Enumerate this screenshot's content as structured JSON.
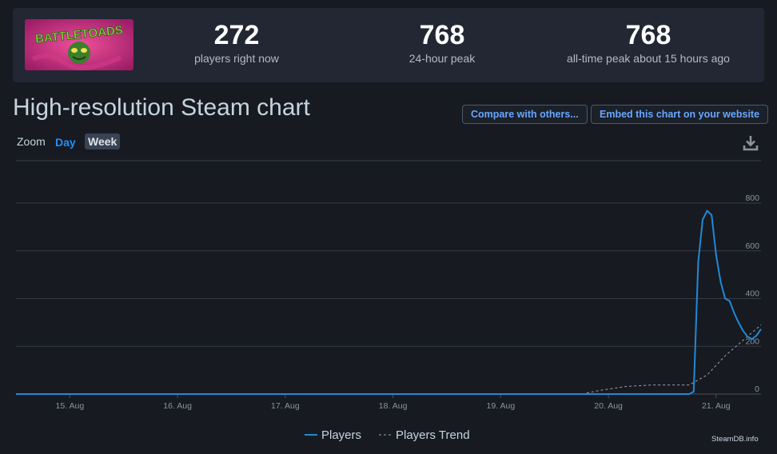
{
  "header": {
    "game_logo_text": "BATTLETOADS",
    "stats": [
      {
        "value": "272",
        "label": "players right now"
      },
      {
        "value": "768",
        "label": "24-hour peak"
      },
      {
        "value": "768",
        "label": "all-time peak about 15 hours ago"
      }
    ]
  },
  "page_title": "High-resolution Steam chart",
  "buttons": {
    "compare": "Compare with others...",
    "embed": "Embed this chart on your website"
  },
  "zoom": {
    "label": "Zoom",
    "options": [
      "Day",
      "Week"
    ],
    "selected": "Week"
  },
  "icons": {
    "download": "download-icon"
  },
  "colors": {
    "background": "#171a21",
    "players_line": "#1f8ad6",
    "trend_line": "#9aa4ae",
    "link_blue": "#67a7ff"
  },
  "credit": "SteamDB.info",
  "chart_data": {
    "type": "line",
    "title": "",
    "xlabel": "",
    "ylabel": "",
    "x_ticks": [
      "15. Aug",
      "16. Aug",
      "17. Aug",
      "18. Aug",
      "19. Aug",
      "20. Aug",
      "21. Aug"
    ],
    "y_ticks": [
      0,
      200,
      400,
      600,
      800
    ],
    "xlim": [
      "2020-08-14 12:00",
      "2020-08-21 10:00"
    ],
    "ylim": [
      0,
      800
    ],
    "grid": true,
    "legend_position": "bottom",
    "series": [
      {
        "name": "Players",
        "style": "solid",
        "color": "#1f8ad6",
        "points": [
          [
            "2020-08-14 12:00",
            0
          ],
          [
            "2020-08-20 18:00",
            0
          ],
          [
            "2020-08-20 19:00",
            10
          ],
          [
            "2020-08-20 20:00",
            550
          ],
          [
            "2020-08-20 21:00",
            730
          ],
          [
            "2020-08-20 22:00",
            768
          ],
          [
            "2020-08-20 23:00",
            750
          ],
          [
            "2020-08-21 00:00",
            580
          ],
          [
            "2020-08-21 01:00",
            470
          ],
          [
            "2020-08-21 02:00",
            400
          ],
          [
            "2020-08-21 03:00",
            390
          ],
          [
            "2020-08-21 04:00",
            340
          ],
          [
            "2020-08-21 05:00",
            300
          ],
          [
            "2020-08-21 06:00",
            265
          ],
          [
            "2020-08-21 07:00",
            240
          ],
          [
            "2020-08-21 08:00",
            230
          ],
          [
            "2020-08-21 09:00",
            245
          ],
          [
            "2020-08-21 10:00",
            272
          ]
        ]
      },
      {
        "name": "Players Trend",
        "style": "dashed",
        "color": "#9aa4ae",
        "points": [
          [
            "2020-08-14 12:00",
            0
          ],
          [
            "2020-08-19 18:00",
            0
          ],
          [
            "2020-08-19 22:00",
            15
          ],
          [
            "2020-08-20 04:00",
            32
          ],
          [
            "2020-08-20 10:00",
            38
          ],
          [
            "2020-08-20 18:00",
            38
          ],
          [
            "2020-08-20 22:00",
            80
          ],
          [
            "2020-08-21 02:00",
            160
          ],
          [
            "2020-08-21 06:00",
            225
          ],
          [
            "2020-08-21 10:00",
            290
          ]
        ]
      }
    ]
  }
}
